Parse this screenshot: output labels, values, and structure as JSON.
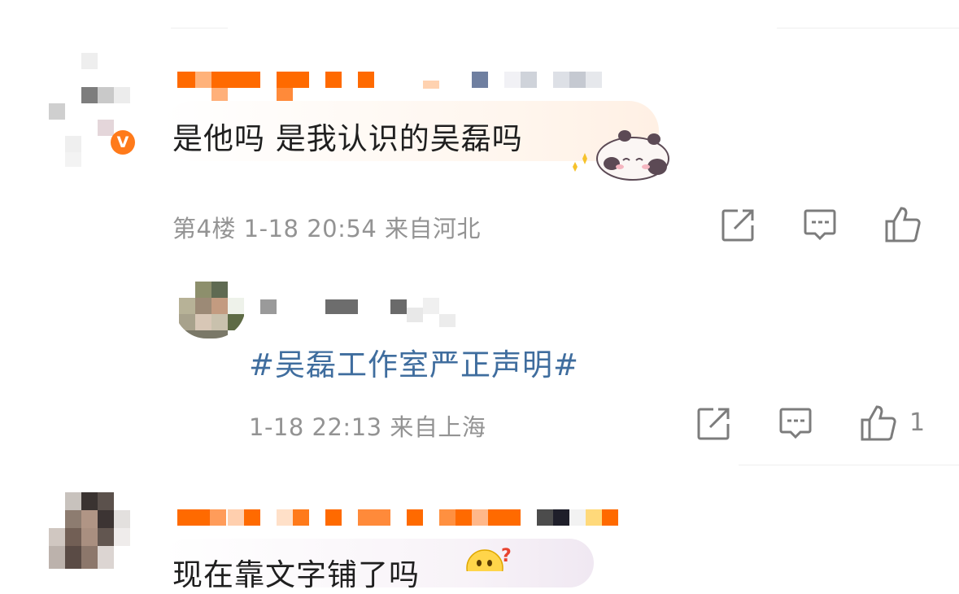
{
  "comments": [
    {
      "text": "是他吗 是我认识的吴磊吗",
      "meta": "第4楼 1-18 20:54 来自河北",
      "verified_badge": "V",
      "reply": {
        "text": "#吴磊工作室严正声明#",
        "meta": "1-18 22:13 来自上海",
        "like_count": "1"
      }
    },
    {
      "text": "现在靠文字铺了吗"
    }
  ],
  "icons": [
    "share-icon",
    "comment-icon",
    "like-icon",
    "sticker-panda-icon",
    "emoji-thinking-icon"
  ],
  "colors": {
    "username": "#ff6a00",
    "topic": "#3f6d9e",
    "meta": "#939393",
    "badge": "#ff7a1a"
  }
}
